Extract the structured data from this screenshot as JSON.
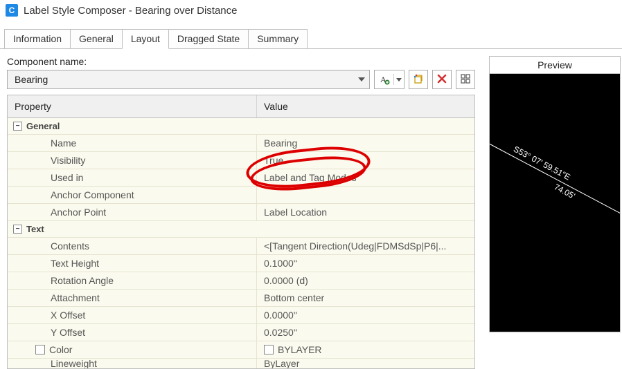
{
  "window": {
    "app_icon_letter": "C",
    "title": "Label Style Composer - Bearing over Distance"
  },
  "tabs": [
    {
      "label": "Information",
      "active": false
    },
    {
      "label": "General",
      "active": false
    },
    {
      "label": "Layout",
      "active": true
    },
    {
      "label": "Dragged State",
      "active": false
    },
    {
      "label": "Summary",
      "active": false
    }
  ],
  "component": {
    "label": "Component name:",
    "selected": "Bearing"
  },
  "toolbar_icons": {
    "add_text": "add-text-component-icon",
    "copy": "copy-component-icon",
    "delete": "delete-component-icon",
    "order": "component-order-icon"
  },
  "grid": {
    "headers": {
      "property": "Property",
      "value": "Value"
    },
    "sections": [
      {
        "name": "General",
        "rows": [
          {
            "prop": "Name",
            "val": "Bearing"
          },
          {
            "prop": "Visibility",
            "val": "True",
            "circled": true
          },
          {
            "prop": "Used in",
            "val": "Label and Tag Modes",
            "circled": true
          },
          {
            "prop": "Anchor Component",
            "val": ""
          },
          {
            "prop": "Anchor Point",
            "val": "Label Location"
          }
        ]
      },
      {
        "name": "Text",
        "rows": [
          {
            "prop": "Contents",
            "val": "<[Tangent Direction(Udeg|FDMSdSp|P6|..."
          },
          {
            "prop": "Text Height",
            "val": "0.1000\""
          },
          {
            "prop": "Rotation Angle",
            "val": "0.0000 (d)"
          },
          {
            "prop": "Attachment",
            "val": "Bottom center"
          },
          {
            "prop": "X Offset",
            "val": "0.0000\""
          },
          {
            "prop": "Y Offset",
            "val": "0.0250\""
          },
          {
            "prop": "Color",
            "val": "BYLAYER",
            "checkbox": true
          },
          {
            "prop": "Lineweight",
            "val": "ByLayer",
            "cut": true
          }
        ]
      }
    ]
  },
  "preview": {
    "title": "Preview",
    "line1": "S53° 07' 59.51\"E",
    "line2": "74.05'"
  }
}
